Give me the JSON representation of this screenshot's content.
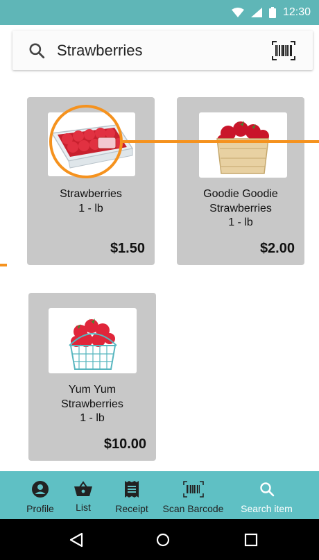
{
  "status_bar": {
    "time": "12:30",
    "icons": [
      "wifi-icon",
      "signal-icon",
      "battery-icon"
    ]
  },
  "search": {
    "query": "Strawberries",
    "icon": "search-icon",
    "barcode_icon": "barcode-scan-icon"
  },
  "products": [
    {
      "name_lines": [
        "Strawberries",
        "1 - lb"
      ],
      "price": "$1.50",
      "image": "strawberries-clamshell"
    },
    {
      "name_lines": [
        "Goodie Goodie",
        "Strawberries",
        "1 - lb"
      ],
      "price": "$2.00",
      "image": "strawberries-wooden-basket"
    },
    {
      "name_lines": [
        "Yum Yum",
        "Strawberries",
        "1 - lb"
      ],
      "price": "$10.00",
      "image": "strawberries-wire-basket"
    }
  ],
  "bottom_nav": {
    "items": [
      {
        "label": "Profile",
        "icon": "profile-icon",
        "active": false
      },
      {
        "label": "List",
        "icon": "basket-icon",
        "active": false
      },
      {
        "label": "Receipt",
        "icon": "receipt-icon",
        "active": false
      },
      {
        "label": "Scan Barcode",
        "icon": "barcode-icon",
        "active": false
      },
      {
        "label": "Search item",
        "icon": "search-icon",
        "active": true
      }
    ]
  },
  "system_nav": {
    "buttons": [
      "back-icon",
      "home-icon",
      "recents-icon"
    ]
  },
  "colors": {
    "status_bar": "#5fb6b7",
    "bottom_nav": "#5fc0c4",
    "card": "#c8c8c8",
    "highlight": "#f5921e",
    "active_nav_label": "#ffffff"
  }
}
